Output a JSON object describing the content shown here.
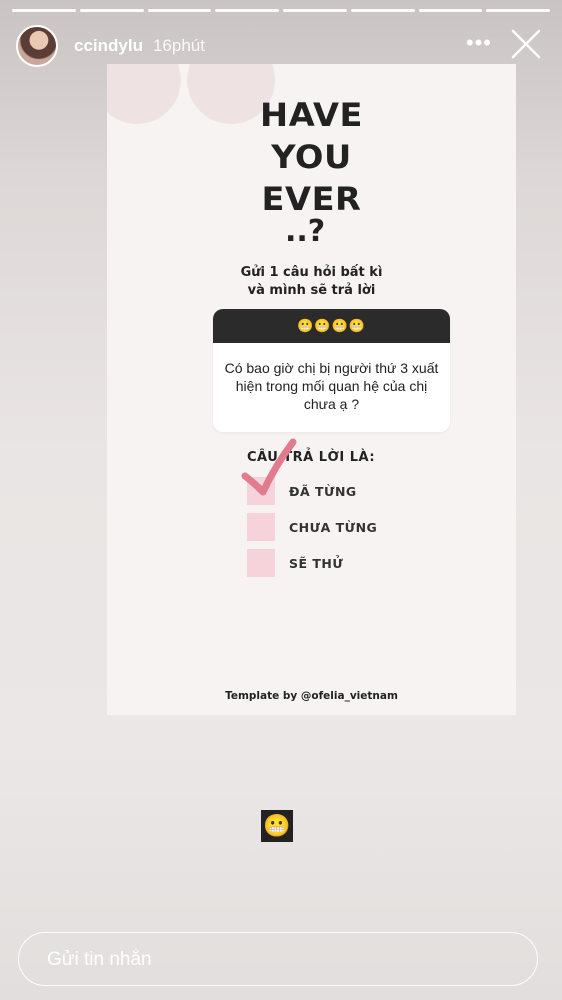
{
  "story": {
    "username": "ccindylu",
    "time": "16phút",
    "more_label": "•••",
    "segments": 8
  },
  "card": {
    "title_lines": [
      "HAVE",
      "YOU",
      "EVER"
    ],
    "dots": "..?",
    "subtitle_line1": "Gửi 1 câu hỏi bất kì",
    "subtitle_line2": "và mình sẽ trả lời",
    "question_box": {
      "emojis": "😬😬😬😬",
      "question": "Có bao giờ chị bị người thứ 3 xuất hiện trong mối quan hệ của chị chưa ạ ?"
    },
    "answer_title": "CÂU TRẢ LỜI LÀ:",
    "options": [
      {
        "label": "ĐÃ TỪNG",
        "checked": true
      },
      {
        "label": "CHƯA TỪNG",
        "checked": false
      },
      {
        "label": "SẼ THỬ",
        "checked": false
      }
    ],
    "template_credit": "Template by @ofelia_vietnam"
  },
  "sticker": {
    "emoji": "😬"
  },
  "message": {
    "placeholder": "Gửi tin nhắn"
  },
  "colors": {
    "box": "#f6d3da",
    "check": "#e17b8e",
    "header_bar": "#2b2b2b"
  }
}
